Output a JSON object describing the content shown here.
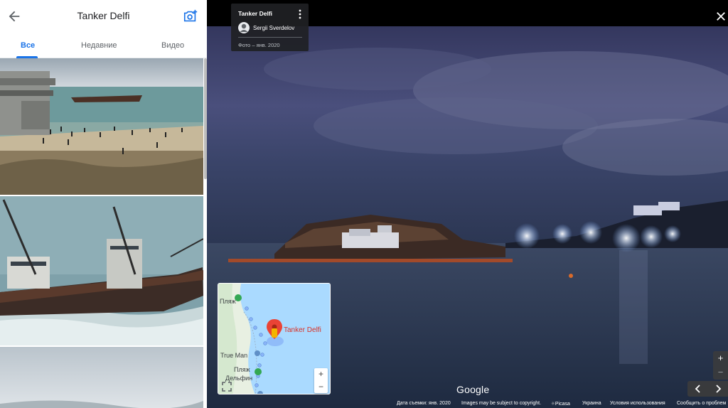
{
  "header": {
    "title": "Tanker Delfi"
  },
  "tabs": [
    {
      "label": "Все",
      "active": true
    },
    {
      "label": "Недавние",
      "active": false
    },
    {
      "label": "Видео",
      "active": false
    }
  ],
  "info_card": {
    "place_name": "Tanker Delfi",
    "author": "Sergii Sverdelov",
    "date": "Фото – янв. 2020"
  },
  "minimap": {
    "place_label": "Tanker Delfi",
    "labels": [
      "Пляж",
      "True Man",
      "Пляж",
      "Дельфин"
    ],
    "zoom_in": "+",
    "zoom_out": "−"
  },
  "viewer": {
    "zoom_in": "+",
    "zoom_out": "−"
  },
  "google_logo": "Google",
  "footer": {
    "capture_date": "Дата съемки: янв. 2020",
    "copyright": "Images may be subject to copyright.",
    "source": "Picasa",
    "country": "Украина",
    "terms": "Условия использования",
    "report": "Сообщить о проблем"
  },
  "colors": {
    "accent": "#1a73e8",
    "pin": "#ea4335"
  }
}
